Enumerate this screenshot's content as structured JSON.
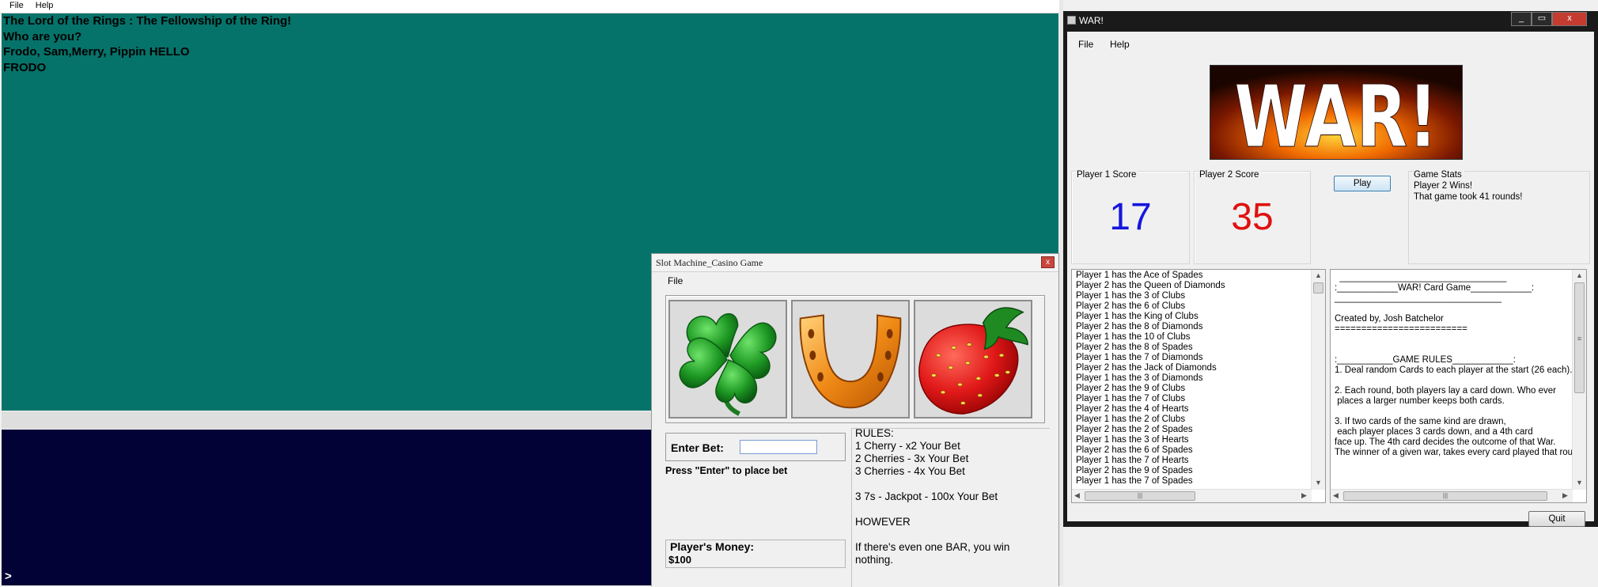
{
  "lotr": {
    "menu": [
      "File",
      "Help"
    ],
    "console_lines": [
      "The Lord of the Rings : The Fellowship of the Ring!",
      "Who are you?",
      "Frodo, Sam,Merry, Pippin HELLO",
      "FRODO"
    ],
    "prompt": ">"
  },
  "slot": {
    "title": "Slot Machine_Casino Game",
    "close_glyph": "x",
    "menu": [
      "File"
    ],
    "reels": [
      "clover-icon",
      "horseshoe-icon",
      "strawberry-icon"
    ],
    "bet_label": "Enter Bet:",
    "bet_value": "",
    "bet_hint": "Press \"Enter\" to place bet",
    "money_label": "Player's Money:",
    "money_value": "$100",
    "rules": [
      "RULES:",
      "1 Cherry - x2 Your Bet",
      "2 Cherries - 3x Your Bet",
      "3 Cherries - 4x You Bet",
      "3 7s - Jackpot - 100x Your Bet",
      "HOWEVER",
      "If there's even one BAR, you win",
      "nothing."
    ]
  },
  "war": {
    "title": "WAR!",
    "controls": [
      "_",
      "▭",
      "x"
    ],
    "menu": [
      "File",
      "Help"
    ],
    "banner_text": "WAR!",
    "player1": {
      "label": "Player 1 Score",
      "score": "17",
      "color": "#1515e0"
    },
    "player2": {
      "label": "Player 2 Score",
      "score": "35",
      "color": "#e01010"
    },
    "play_label": "Play",
    "stats": {
      "label": "Game Stats",
      "lines": [
        "Player 2 Wins!",
        "That game took 41 rounds!"
      ]
    },
    "log": [
      "Player 1 has the Ace of Spades",
      "Player 2 has the Queen of Diamonds",
      "Player 1 has the 3 of Clubs",
      "Player 2 has the 6 of Clubs",
      "Player 1 has the King of Clubs",
      "Player 2 has the 8 of Diamonds",
      "Player 1 has the 10 of Clubs",
      "Player 2 has the 8 of Spades",
      "Player 1 has the 7 of Diamonds",
      "Player 2 has the Jack of Diamonds",
      "Player 1 has the 3 of Diamonds",
      "Player 2 has the 9 of Clubs",
      "Player 1 has the 7 of Clubs",
      "Player 2 has the 4 of Hearts",
      "Player 1 has the 2 of Clubs",
      "Player 2 has the 2 of Spades",
      "Player 1 has the 3 of Hearts",
      "Player 2 has the 6 of Spades",
      "Player 1 has the 7 of Hearts",
      "Player 2 has the 9 of Spades",
      "Player 1 has the 7 of Spades"
    ],
    "rules_text": [
      "  _________________________________",
      ":____________WAR! Card Game____________:",
      "_________________________________",
      "",
      "Created by, Josh Batchelor",
      "=========================",
      "",
      "",
      ":___________GAME RULES____________:",
      "1. Deal random Cards to each player at the start (26 each).",
      "",
      "2. Each round, both players lay a card down. Who ever",
      " places a larger number keeps both cards.",
      "",
      "3. If two cards of the same kind are drawn,",
      " each player places 3 cards down, and a 4th card",
      "face up. The 4th card decides the outcome of that War.",
      "The winner of a given war, takes every card played that round"
    ],
    "quit_label": "Quit",
    "scroll_glyphs": {
      "up": "▲",
      "down": "▼",
      "left": "◀",
      "right": "▶",
      "grip": "|||",
      "grip_h": "≡"
    }
  }
}
